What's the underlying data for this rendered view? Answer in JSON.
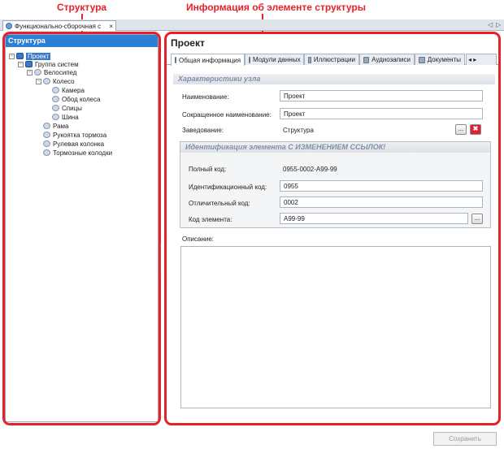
{
  "annotations": {
    "left": "Структура",
    "right": "Информация об элементе структуры"
  },
  "doc_tab": {
    "title": "Функционально-сборочная с",
    "close": "×"
  },
  "nav": {
    "left": "◁",
    "right": "▷"
  },
  "tree": {
    "header": "Структура",
    "nodes": [
      {
        "label": "Проект",
        "toggle": "−",
        "icon": "blue"
      },
      {
        "label": "Группа систем",
        "toggle": "−",
        "icon": "blue"
      },
      {
        "label": "Велосипед",
        "toggle": "−",
        "icon": "circle"
      },
      {
        "label": "Колесо",
        "toggle": "−",
        "icon": "circle"
      },
      {
        "label": "Камера",
        "toggle": "",
        "icon": "circle"
      },
      {
        "label": "Обод колеса",
        "toggle": "",
        "icon": "circle"
      },
      {
        "label": "Спицы",
        "toggle": "",
        "icon": "circle"
      },
      {
        "label": "Шина",
        "toggle": "",
        "icon": "circle"
      },
      {
        "label": "Рама",
        "toggle": "",
        "icon": "circle"
      },
      {
        "label": "Рукоятка тормоза",
        "toggle": "",
        "icon": "circle"
      },
      {
        "label": "Рулевая колонка",
        "toggle": "",
        "icon": "circle"
      },
      {
        "label": "Тормозные колодки",
        "toggle": "",
        "icon": "circle"
      }
    ]
  },
  "detail": {
    "title": "Проект",
    "tabs": [
      "Общая информация",
      "Модули данных",
      "Иллюстрации",
      "Аудиозаписи",
      "Документы"
    ],
    "tab_more": "◂ ▸",
    "section": "Характеристики узла",
    "fields": {
      "name_label": "Наименование:",
      "name_value": "Проект",
      "short_label": "Сокращенное наименование:",
      "short_value": "Проект",
      "parent_label": "Заведование:",
      "parent_value": "Структура"
    },
    "ident": {
      "header": "Идентификация элемента С ИЗМЕНЕНИЕМ ССЫЛОК!",
      "full_label": "Полный код:",
      "full_value": "0955-0002-A99-99",
      "id_label": "Идентификационный код:",
      "id_value": "0955",
      "dist_label": "Отличительный код:",
      "dist_value": "0002",
      "elem_label": "Код элемента:",
      "elem_value": "A99-99"
    },
    "desc_label": "Описание:",
    "ellipsis": "...",
    "clear": "✖"
  },
  "save_label": "Сохранить"
}
